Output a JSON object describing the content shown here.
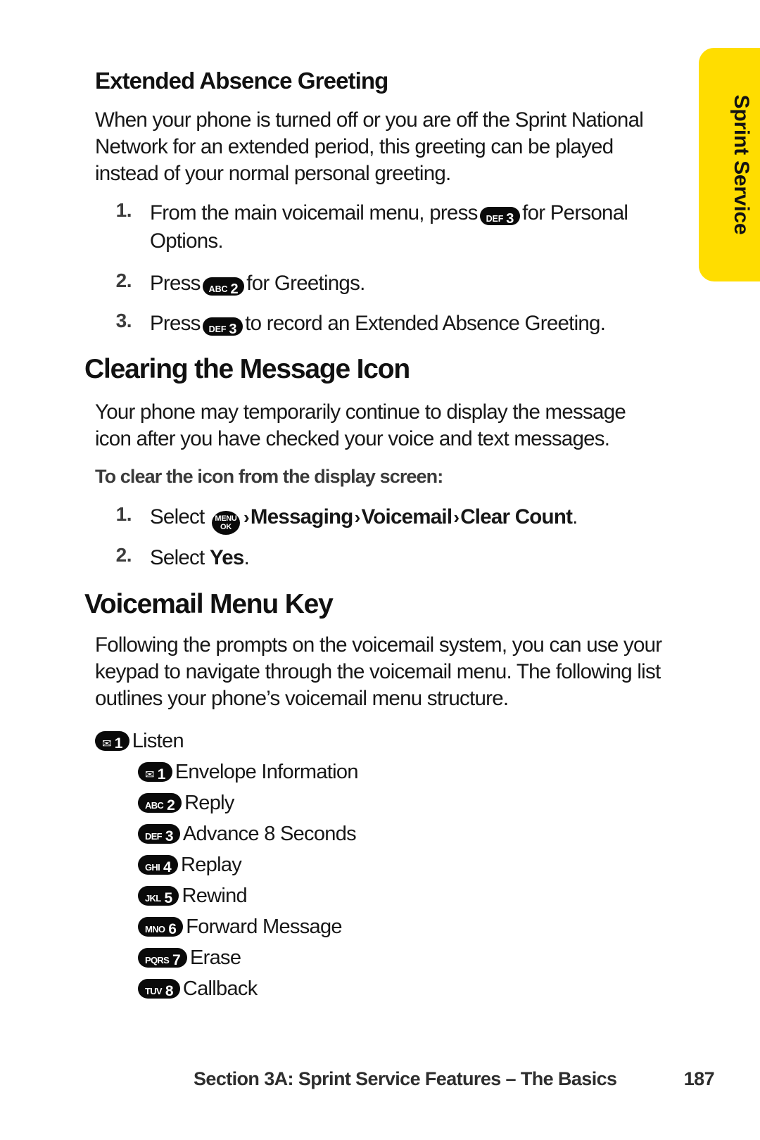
{
  "side_tab": {
    "label": "Sprint Service",
    "color": "#ffdd00"
  },
  "sections": {
    "extended_absence": {
      "heading": "Extended Absence Greeting",
      "paragraph": "When your phone is turned off or you are off the Sprint National Network for an extended period, this greeting can be played instead of your normal personal greeting.",
      "steps": [
        {
          "num": "1.",
          "before": "From the main voicemail menu, press",
          "key": {
            "letters": "DEF",
            "digit": "3"
          },
          "after": "for Personal Options."
        },
        {
          "num": "2.",
          "before": "Press",
          "key": {
            "letters": "ABC",
            "digit": "2"
          },
          "after": "for Greetings."
        },
        {
          "num": "3.",
          "before": "Press",
          "key": {
            "letters": "DEF",
            "digit": "3"
          },
          "after": "to record an Extended Absence Greeting."
        }
      ]
    },
    "clearing_message_icon": {
      "heading": "Clearing the Message Icon",
      "paragraph": "Your phone may temporarily continue to display the message icon after you have checked your voice and text messages.",
      "subhead": "To clear the icon from the display screen:",
      "steps": [
        {
          "num": "1.",
          "before": "Select",
          "menu_key": {
            "top": "MENU",
            "bottom": "OK"
          },
          "path": [
            "Messaging",
            "Voicemail",
            "Clear Count"
          ],
          "separator": "›",
          "after": "."
        },
        {
          "num": "2.",
          "before": "Select",
          "bold": "Yes",
          "after": "."
        }
      ]
    },
    "voicemail_menu_key": {
      "heading": "Voicemail Menu Key",
      "paragraph": "Following the prompts on the voicemail system, you can use your keypad to navigate through the voicemail menu. The following list outlines your phone’s voicemail menu structure.",
      "tree": [
        {
          "level": 0,
          "key": {
            "letters": "envelope-icon",
            "digit": "1"
          },
          "label": "Listen"
        },
        {
          "level": 1,
          "key": {
            "letters": "envelope-icon",
            "digit": "1"
          },
          "label": "Envelope Information"
        },
        {
          "level": 1,
          "key": {
            "letters": "ABC",
            "digit": "2"
          },
          "label": "Reply"
        },
        {
          "level": 1,
          "key": {
            "letters": "DEF",
            "digit": "3"
          },
          "label": "Advance 8 Seconds"
        },
        {
          "level": 1,
          "key": {
            "letters": "GHI",
            "digit": "4"
          },
          "label": "Replay"
        },
        {
          "level": 1,
          "key": {
            "letters": "JKL",
            "digit": "5"
          },
          "label": "Rewind"
        },
        {
          "level": 1,
          "key": {
            "letters": "MNO",
            "digit": "6"
          },
          "label": "Forward Message"
        },
        {
          "level": 1,
          "key": {
            "letters": "PQRS",
            "digit": "7"
          },
          "label": "Erase"
        },
        {
          "level": 1,
          "key": {
            "letters": "TUV",
            "digit": "8"
          },
          "label": "Callback"
        }
      ]
    }
  },
  "footer": {
    "section_text": "Section 3A: Sprint Service Features – The Basics",
    "page_number": "187"
  }
}
